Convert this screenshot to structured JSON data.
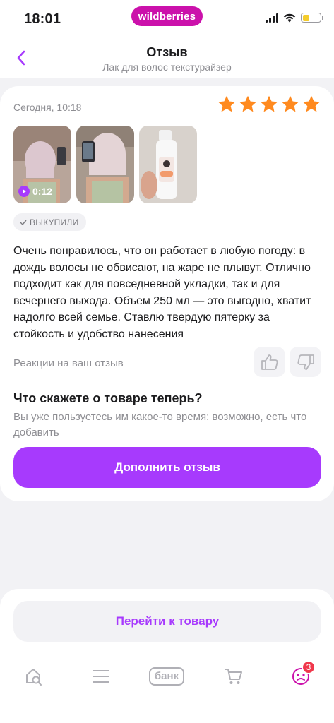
{
  "status_bar": {
    "time": "18:01",
    "brand": "wildberries",
    "icons": [
      "cellular-signal-icon",
      "wifi-icon",
      "battery-icon"
    ]
  },
  "header": {
    "title": "Отзыв",
    "subtitle": "Лак для волос текстурайзер",
    "back_icon": "chevron-left-icon"
  },
  "review": {
    "date": "Сегодня, 10:18",
    "rating": 5,
    "rating_max": 5,
    "photos": [
      {
        "kind": "video",
        "duration": "0:12"
      },
      {
        "kind": "photo"
      },
      {
        "kind": "photo"
      }
    ],
    "purchased_label": "ВЫКУПИЛИ",
    "text": "Очень понравилось, что он работает в любую погоду: в дождь волосы не обвисают, на жаре не плывут. Отлично подходит как для повседневной укладки, так и для вечернего выхода. Объем 250 мл — это выгодно, хватит надолго всей семье. Ставлю твердую пятерку за стойкость и удобство нанесения",
    "reactions_label": "Реакции на ваш отзыв"
  },
  "prompt": {
    "title": "Что скажете о товаре теперь?",
    "text": "Вы уже пользуетесь им какое-то время: возможно, есть что добавить",
    "button_label": "Дополнить отзыв"
  },
  "goto_product_label": "Перейти к товару",
  "tabbar": {
    "items": [
      {
        "name": "home",
        "icon": "home-search-icon"
      },
      {
        "name": "catalog",
        "icon": "menu-icon"
      },
      {
        "name": "bank",
        "label": "банк"
      },
      {
        "name": "cart",
        "icon": "cart-icon"
      },
      {
        "name": "profile",
        "icon": "profile-icon",
        "badge": "3"
      }
    ]
  },
  "colors": {
    "brand": "#cb11ab",
    "accent": "#a73afd",
    "star": "#ff8a1f",
    "badge": "#f0374b"
  }
}
